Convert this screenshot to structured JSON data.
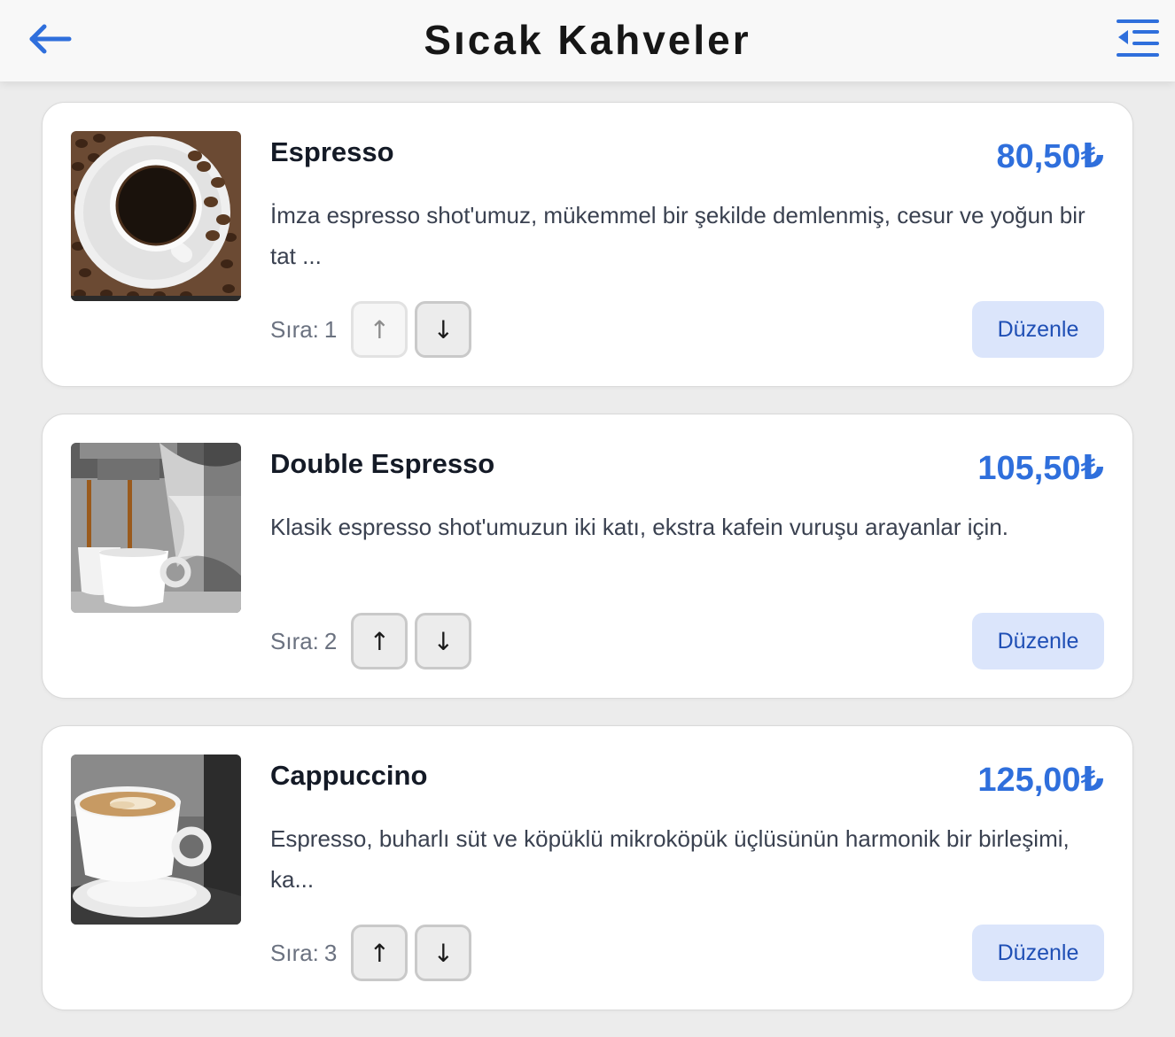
{
  "header": {
    "title": "Sıcak Kahveler",
    "back_icon": "arrow-left-icon",
    "menu_icon": "menu-collapse-icon",
    "accent_color": "#2f6fdc"
  },
  "items": [
    {
      "name": "Espresso",
      "price": "80,50₺",
      "description": "İmza espresso shot'umuz, mükemmel bir şekilde demlenmiş, cesur ve yoğun bir tat ...",
      "order_label": "Sıra:",
      "order": "1",
      "up_label": "↑",
      "down_label": "↓",
      "up_disabled": true,
      "edit_label": "Düzenle"
    },
    {
      "name": "Double Espresso",
      "price": "105,50₺",
      "description": "Klasik espresso shot'umuzun iki katı, ekstra kafein vuruşu arayanlar için.",
      "order_label": "Sıra:",
      "order": "2",
      "up_label": "↑",
      "down_label": "↓",
      "up_disabled": false,
      "edit_label": "Düzenle"
    },
    {
      "name": "Cappuccino",
      "price": "125,00₺",
      "description": "Espresso, buharlı süt ve köpüklü mikroköpük üçlüsünün harmonik bir birleşimi, ka...",
      "order_label": "Sıra:",
      "order": "3",
      "up_label": "↑",
      "down_label": "↓",
      "up_disabled": false,
      "edit_label": "Düzenle"
    }
  ]
}
